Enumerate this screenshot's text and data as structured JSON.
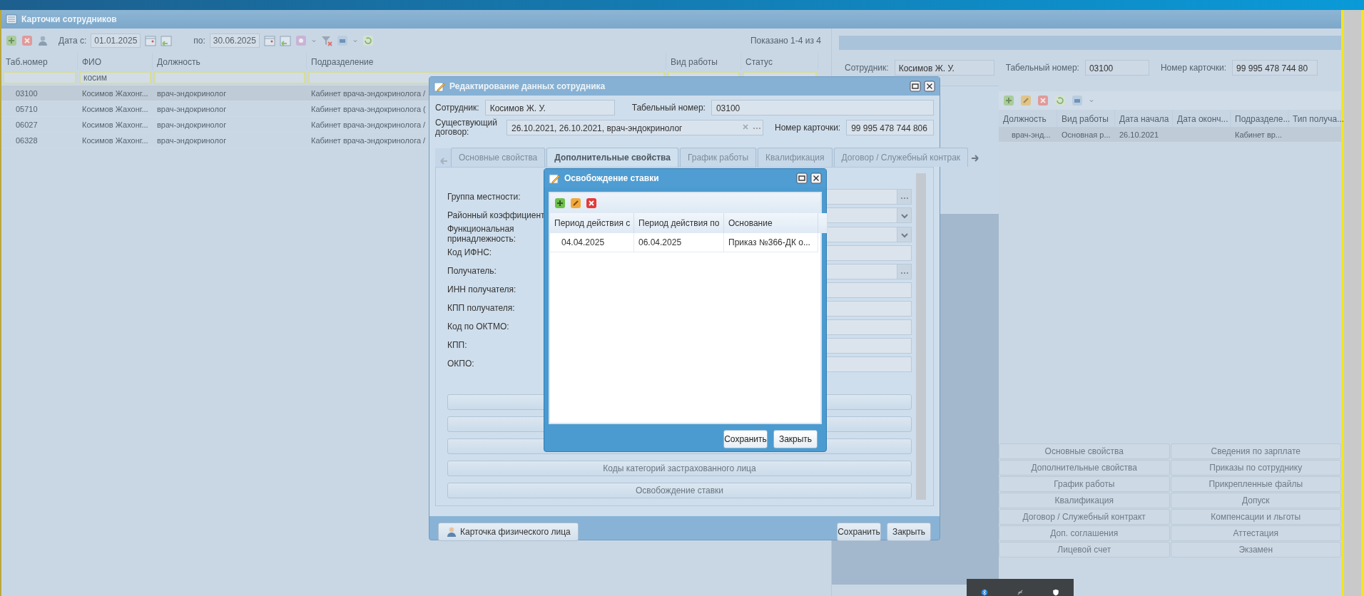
{
  "window": {
    "title": "Карточки сотрудников"
  },
  "toolbar": {
    "date_from_label": "Дата с:",
    "date_from": "01.01.2025",
    "date_to_label": "по:",
    "date_to": "30.06.2025",
    "summary": "Показано 1-4 из 4"
  },
  "employees_grid": {
    "columns": [
      {
        "label": "Таб.номер"
      },
      {
        "label": "ФИО",
        "filter": "косим"
      },
      {
        "label": "Должность"
      },
      {
        "label": "Подразделение"
      },
      {
        "label": "Вид работы"
      },
      {
        "label": "Статус"
      }
    ],
    "rows": [
      {
        "selected": true,
        "cells": [
          "03100",
          "Косимов Жахонг...",
          "врач-эндокринолог",
          "Кабинет врача-эндокринолога /"
        ]
      },
      {
        "selected": false,
        "cells": [
          "05710",
          "Косимов Жахонг...",
          "врач-эндокринолог",
          "Кабинет врача-эндокринолога ("
        ]
      },
      {
        "selected": false,
        "cells": [
          "06027",
          "Косимов Жахонг...",
          "врач-эндокринолог",
          "Кабинет врача-эндокринолога /"
        ]
      },
      {
        "selected": false,
        "cells": [
          "06328",
          "Косимов Жахонг...",
          "врач-эндокринолог",
          "Кабинет врача-эндокринолога /"
        ]
      }
    ]
  },
  "detail_panel": {
    "fields": [
      {
        "label": "Сотрудник:",
        "value": "Косимов Ж. У."
      },
      {
        "label": "Табельный номер:",
        "value": "03100"
      },
      {
        "label": "Номер карточки:",
        "value": "99 995 478 744 80"
      }
    ],
    "grid": {
      "columns": [
        "Должность",
        "Вид работы",
        "Дата начала",
        "Дата оконч...",
        "Подразделе...",
        "Тип получа..."
      ],
      "rows": [
        {
          "selected": true,
          "cells": [
            "врач-энд...",
            "Основная р...",
            "26.10.2021",
            null,
            "Кабинет вр...",
            null
          ]
        }
      ]
    },
    "sections": [
      [
        "Основные свойства",
        "Сведения по зарплате"
      ],
      [
        "Дополнительные свойства",
        "Приказы по сотруднику"
      ],
      [
        "График работы",
        "Прикрепленные файлы"
      ],
      [
        "Квалификация",
        "Допуск"
      ],
      [
        "Договор / Служебный контракт",
        "Компенсации и льготы"
      ],
      [
        "Доп. соглашения",
        "Аттестация"
      ],
      [
        "Лицевой счет",
        "Экзамен"
      ]
    ]
  },
  "edit_dialog": {
    "title": "Редактирование данных сотрудника",
    "employee": {
      "label": "Сотрудник:",
      "value": "Косимов Ж. У."
    },
    "tab_number": {
      "label": "Табельный номер:",
      "value": "03100"
    },
    "contract": {
      "label": "Существующий договор:",
      "value": "26.10.2021, 26.10.2021, врач-эндокринолог"
    },
    "card_number": {
      "label": "Номер карточки:",
      "value": "99 995 478 744 806"
    },
    "tabs": [
      {
        "label": "Основные свойства",
        "selected": false
      },
      {
        "label": "Дополнительные свойства",
        "selected": true
      },
      {
        "label": "График работы",
        "selected": false
      },
      {
        "label": "Квалификация",
        "selected": false
      },
      {
        "label": "Договор / Служебный контрак",
        "selected": false
      }
    ],
    "form": [
      {
        "label": "Группа местности:",
        "kind": "trigger"
      },
      {
        "label": "Районный коэффициент",
        "kind": "combo"
      },
      {
        "label": "Функциональная принадлежность:",
        "kind": "combo"
      },
      {
        "label": "Код ИФНС:",
        "kind": "text"
      },
      {
        "label": "Получатель:",
        "kind": "trigger"
      },
      {
        "label": "ИНН получателя:",
        "kind": "text"
      },
      {
        "label": "КПП получателя:",
        "kind": "text"
      },
      {
        "label": "Код по ОКТМО:",
        "kind": "text"
      },
      {
        "label": "КПП:",
        "kind": "text"
      },
      {
        "label": "ОКПО:",
        "kind": "text"
      }
    ],
    "section_buttons": [
      {
        "kind": "covered"
      },
      {
        "kind": "covered"
      },
      {
        "kind": "covered"
      },
      {
        "kind": "labeled",
        "label": "Коды категорий застрахованного лица"
      },
      {
        "kind": "labeled",
        "label": "Освобождение ставки"
      }
    ],
    "person_card_button": "Карточка физического лица",
    "buttons": [
      "Сохранить",
      "Закрыть"
    ]
  },
  "release_dialog": {
    "title": "Освобождение ставки",
    "columns": [
      "Период действия с",
      "Период действия по",
      "Основание"
    ],
    "rows": [
      {
        "cells": [
          "04.04.2025",
          "06.04.2025",
          "Приказ №366-ДК о..."
        ]
      }
    ],
    "buttons": [
      "Сохранить",
      "Закрыть"
    ]
  }
}
